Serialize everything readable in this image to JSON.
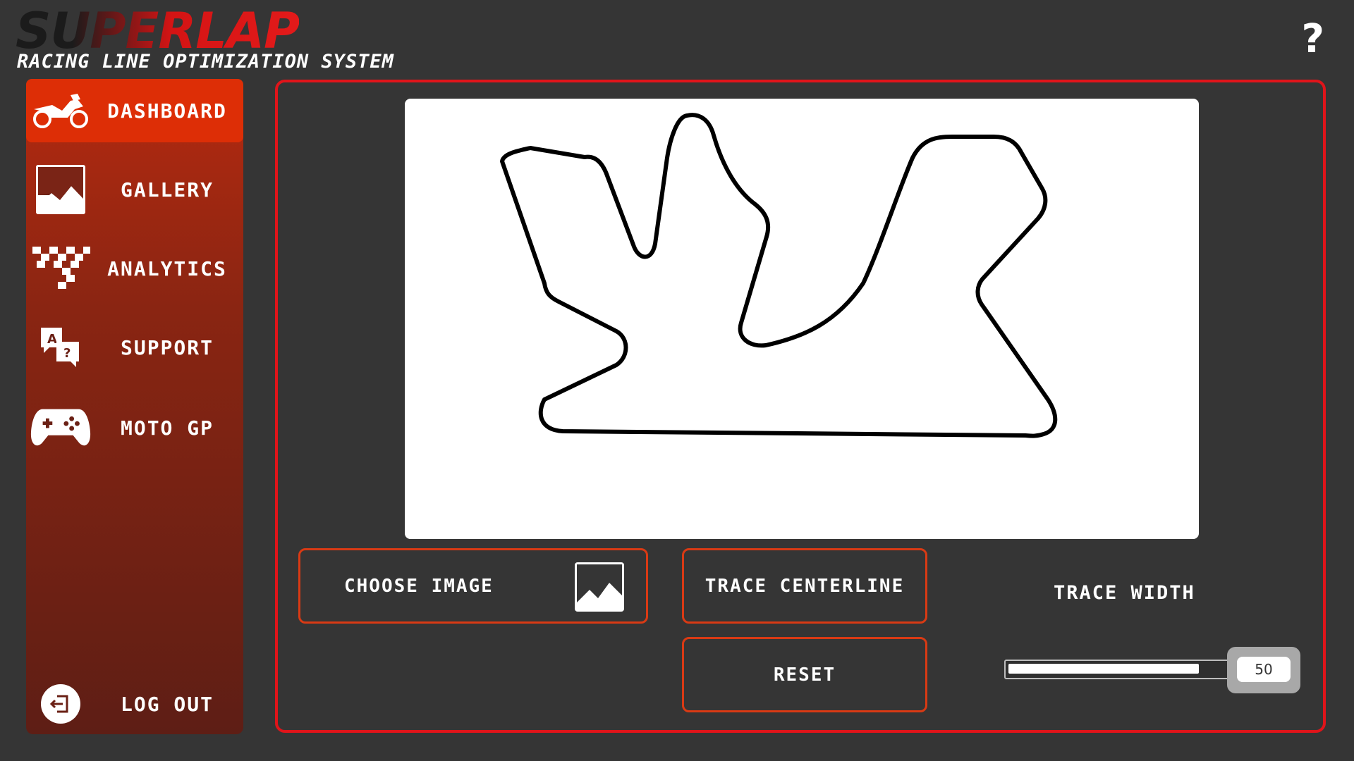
{
  "app": {
    "logo_text": "SUPERLAP",
    "subtitle": "RACING LINE OPTIMIZATION SYSTEM",
    "help_symbol": "?"
  },
  "sidebar": {
    "items": [
      {
        "label": "DASHBOARD",
        "icon": "motorcycle-icon",
        "active": true
      },
      {
        "label": "GALLERY",
        "icon": "image-icon",
        "active": false
      },
      {
        "label": "ANALYTICS",
        "icon": "checkered-flag-icon",
        "active": false
      },
      {
        "label": "SUPPORT",
        "icon": "support-chat-icon",
        "active": false
      },
      {
        "label": "MOTO GP",
        "icon": "gamepad-icon",
        "active": false
      }
    ],
    "logout_label": "LOG OUT",
    "logout_icon": "logout-icon"
  },
  "main": {
    "choose_image_label": "CHOOSE IMAGE",
    "choose_image_icon": "image-icon",
    "trace_centerline_label": "TRACE CENTERLINE",
    "reset_label": "RESET",
    "trace_width_label": "TRACE WIDTH",
    "trace_width_value": "50",
    "trace_width_fraction": 0.85
  },
  "colors": {
    "background": "#353535",
    "accent": "#e0141a",
    "active_nav": "#dd2e06",
    "button_border": "#d93a14"
  }
}
